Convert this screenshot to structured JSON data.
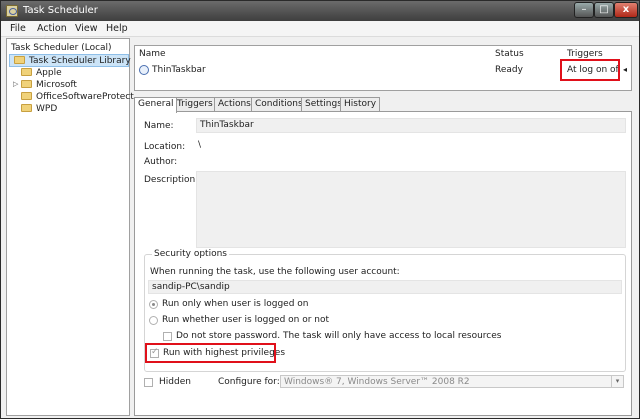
{
  "window": {
    "title": "Task Scheduler",
    "min": "–",
    "max": "□",
    "close": "x"
  },
  "menu": {
    "file": "File",
    "action": "Action",
    "view": "View",
    "help": "Help"
  },
  "tree": {
    "root": "Task Scheduler (Local)",
    "library": "Task Scheduler Library",
    "folders": [
      "Apple",
      "Microsoft",
      "OfficeSoftwareProtect",
      "WPD"
    ],
    "expander": "▷"
  },
  "tasklist": {
    "columns": {
      "name": "Name",
      "status": "Status",
      "triggers": "Triggers"
    },
    "row": {
      "name": "ThinTaskbar",
      "status": "Ready",
      "triggers": "At log on of"
    },
    "more": "◂"
  },
  "tabs": [
    "General",
    "Triggers",
    "Actions",
    "Conditions",
    "Settings",
    "History"
  ],
  "general": {
    "name_label": "Name:",
    "name_value": "ThinTaskbar",
    "location_label": "Location:",
    "location_value": "\\",
    "author_label": "Author:",
    "description_label": "Description:"
  },
  "security": {
    "title": "Security options",
    "account_prompt": "When running the task, use the following user account:",
    "account_value": "sandip-PC\\sandip",
    "run_logged_on": "Run only when user is logged on",
    "run_whether": "Run whether user is logged on or not",
    "no_store_password": "Do not store password.  The task will only have access to local resources",
    "highest_privileges": "Run with highest privileges"
  },
  "bottom": {
    "hidden_label": "Hidden",
    "configure_label": "Configure for:",
    "configure_value": "Windows® 7, Windows Server™ 2008 R2",
    "arrow": "▾"
  },
  "colors": {
    "highlight": "#e0101a",
    "selection": "#cce4f7"
  }
}
